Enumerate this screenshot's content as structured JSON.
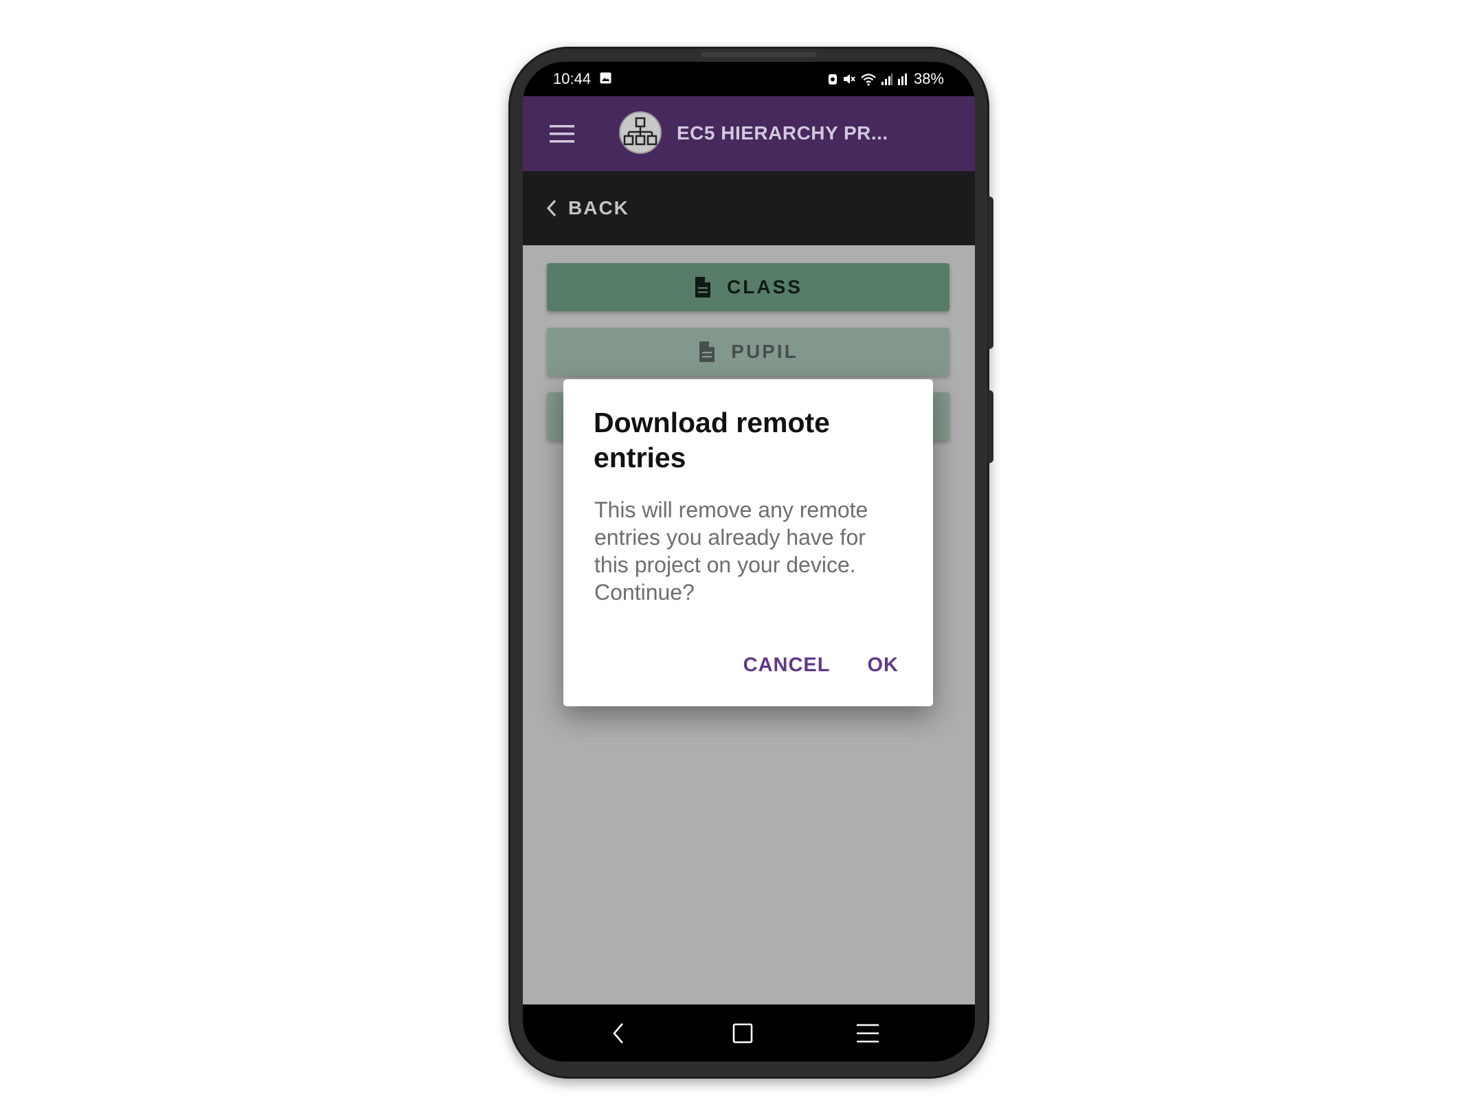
{
  "status_bar": {
    "time": "10:44",
    "battery": "38%",
    "icons": [
      "gallery-icon",
      "alarm-icon",
      "mute-icon",
      "wifi-icon",
      "signal-icon",
      "signal-icon-2"
    ]
  },
  "app_bar": {
    "title": "EC5 HIERARCHY PR...",
    "icons": [
      "menu-icon",
      "project-logo-icon"
    ],
    "background": "#47295e"
  },
  "back_bar": {
    "label": "BACK",
    "icon": "chevron-left-icon"
  },
  "forms": [
    {
      "label": "CLASS",
      "icon": "document-icon"
    },
    {
      "label": "PUPIL",
      "icon": "document-icon"
    }
  ],
  "dialog": {
    "title": "Download remote entries",
    "message": "This will remove any remote entries you already have for this project on your device. Continue?",
    "cancel_label": "CANCEL",
    "ok_label": "OK",
    "accent": "#5e3a86"
  },
  "nav_bar": {
    "icons": [
      "back-nav-icon",
      "home-nav-icon",
      "recents-nav-icon"
    ]
  }
}
